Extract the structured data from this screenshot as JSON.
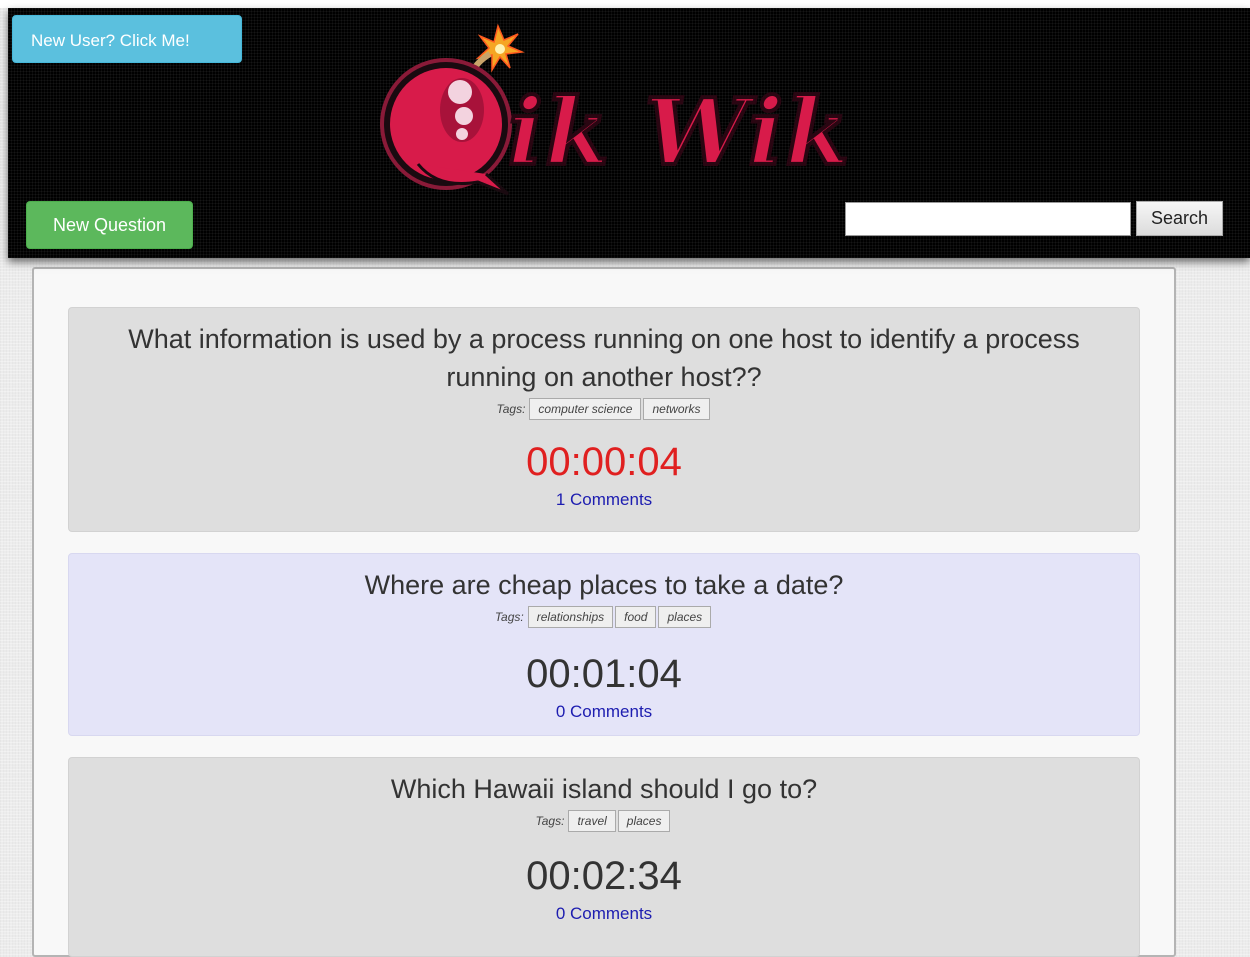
{
  "header": {
    "new_user_button": "New User? Click Me!",
    "new_question_button": "New Question",
    "search_placeholder": "",
    "search_button": "Search",
    "logo_text": "QikWik"
  },
  "colors": {
    "logo_red": "#d81b4a",
    "urgent_timer": "#e02020",
    "comment_link": "#1d1db0"
  },
  "questions": [
    {
      "title": "What information is used by a process running on one host to identify a process running on another host??",
      "tags_label": "Tags:",
      "tags": [
        "computer science",
        "networks"
      ],
      "timer": "00:00:04",
      "comments": "1 Comments"
    },
    {
      "title": "Where are cheap places to take a date?",
      "tags_label": "Tags:",
      "tags": [
        "relationships",
        "food",
        "places"
      ],
      "timer": "00:01:04",
      "comments": "0 Comments"
    },
    {
      "title": "Which Hawaii island should I go to?",
      "tags_label": "Tags:",
      "tags": [
        "travel",
        "places"
      ],
      "timer": "00:02:34",
      "comments": "0 Comments"
    }
  ]
}
